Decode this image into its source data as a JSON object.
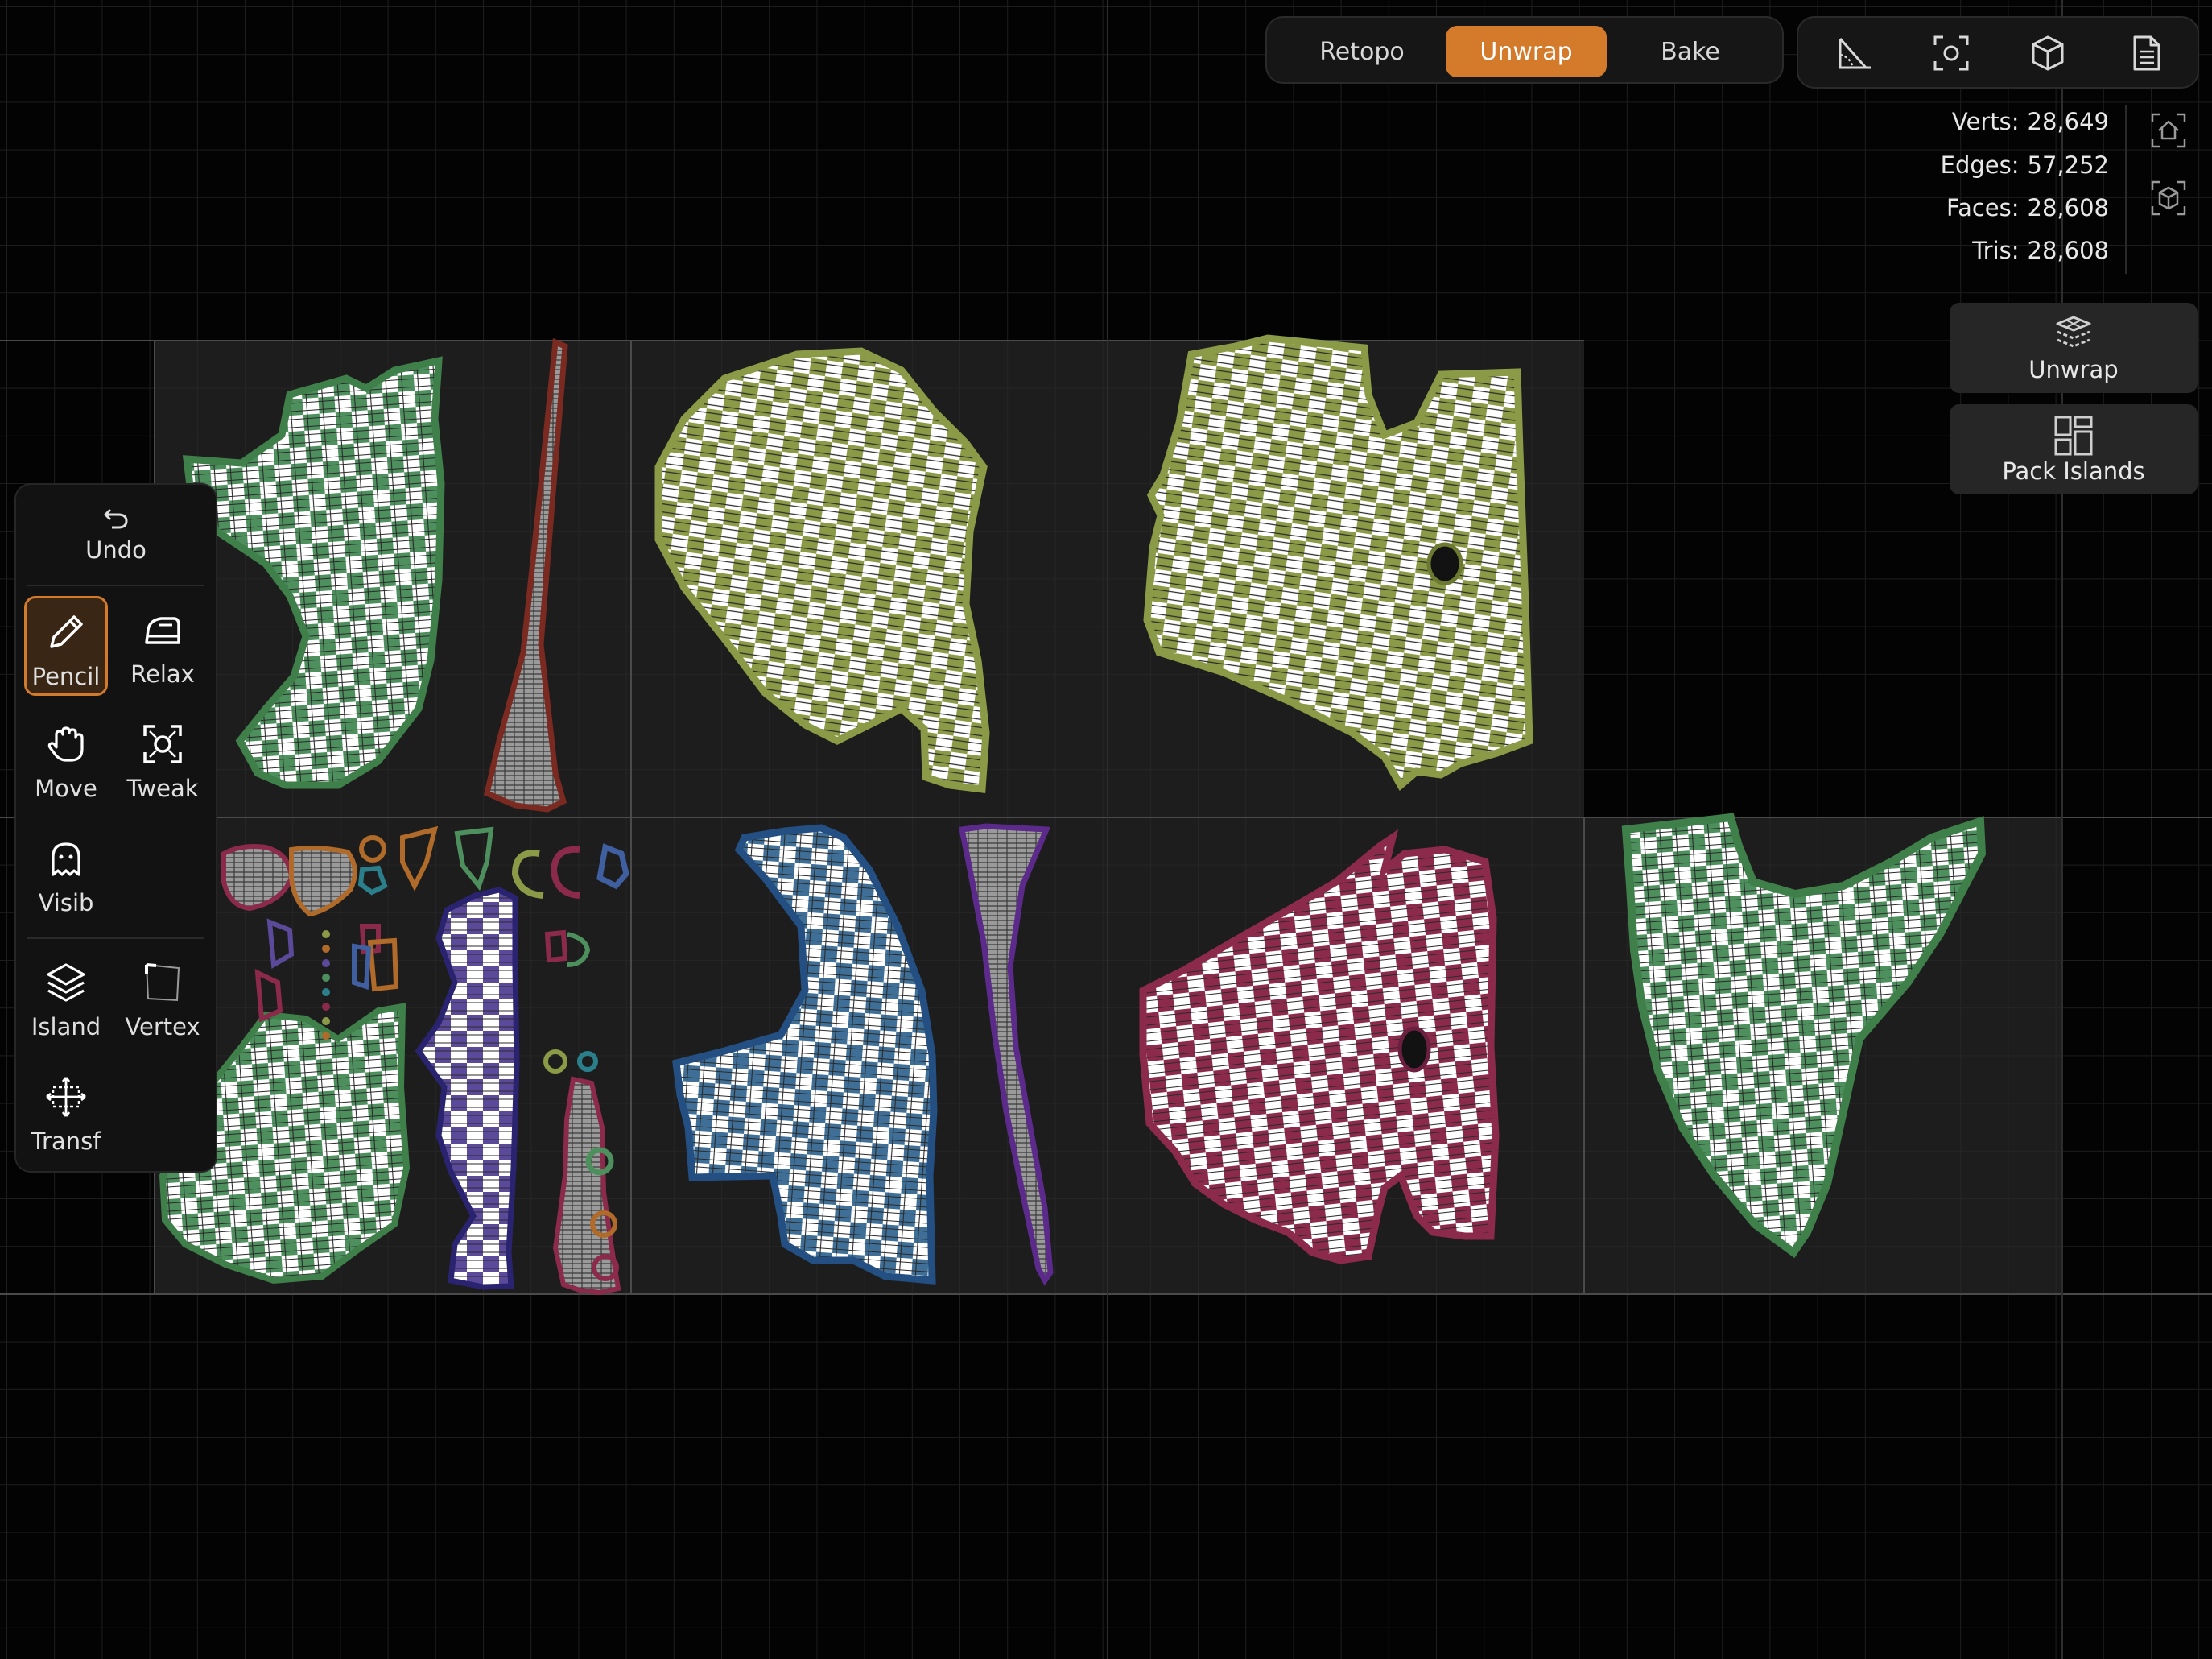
{
  "colors": {
    "accent": "#d37a2b",
    "background": "#030303",
    "panel": "#161616",
    "island_olive": "#8b9a46",
    "island_green": "#4e8f5e",
    "island_blue": "#3f6f96",
    "island_purple": "#5b4a9a",
    "island_maroon": "#8c2a4c",
    "island_rust": "#7a2a20"
  },
  "modes": {
    "retopo": "Retopo",
    "unwrap": "Unwrap",
    "bake": "Bake",
    "active": "Unwrap"
  },
  "view_tools": [
    {
      "icon": "measure-angle-icon"
    },
    {
      "icon": "focus-frame-icon"
    },
    {
      "icon": "cube-view-icon"
    },
    {
      "icon": "document-icon"
    }
  ],
  "stats": {
    "verts_label": "Verts:",
    "verts_value": "28,649",
    "edges_label": "Edges:",
    "edges_value": "57,252",
    "faces_label": "Faces:",
    "faces_value": "28,608",
    "tris_label": "Tris:",
    "tris_value": "28,608"
  },
  "side_icons": [
    "home-view-icon",
    "cube-outline-icon"
  ],
  "actions": {
    "unwrap_label": "Unwrap",
    "pack_label": "Pack Islands"
  },
  "toolbar": {
    "undo": "Undo",
    "pencil": "Pencil",
    "relax": "Relax",
    "move": "Move",
    "tweak": "Tweak",
    "visib": "Visib",
    "island": "Island",
    "vertex": "Vertex",
    "transf": "Transf",
    "active_tool": "Pencil"
  }
}
